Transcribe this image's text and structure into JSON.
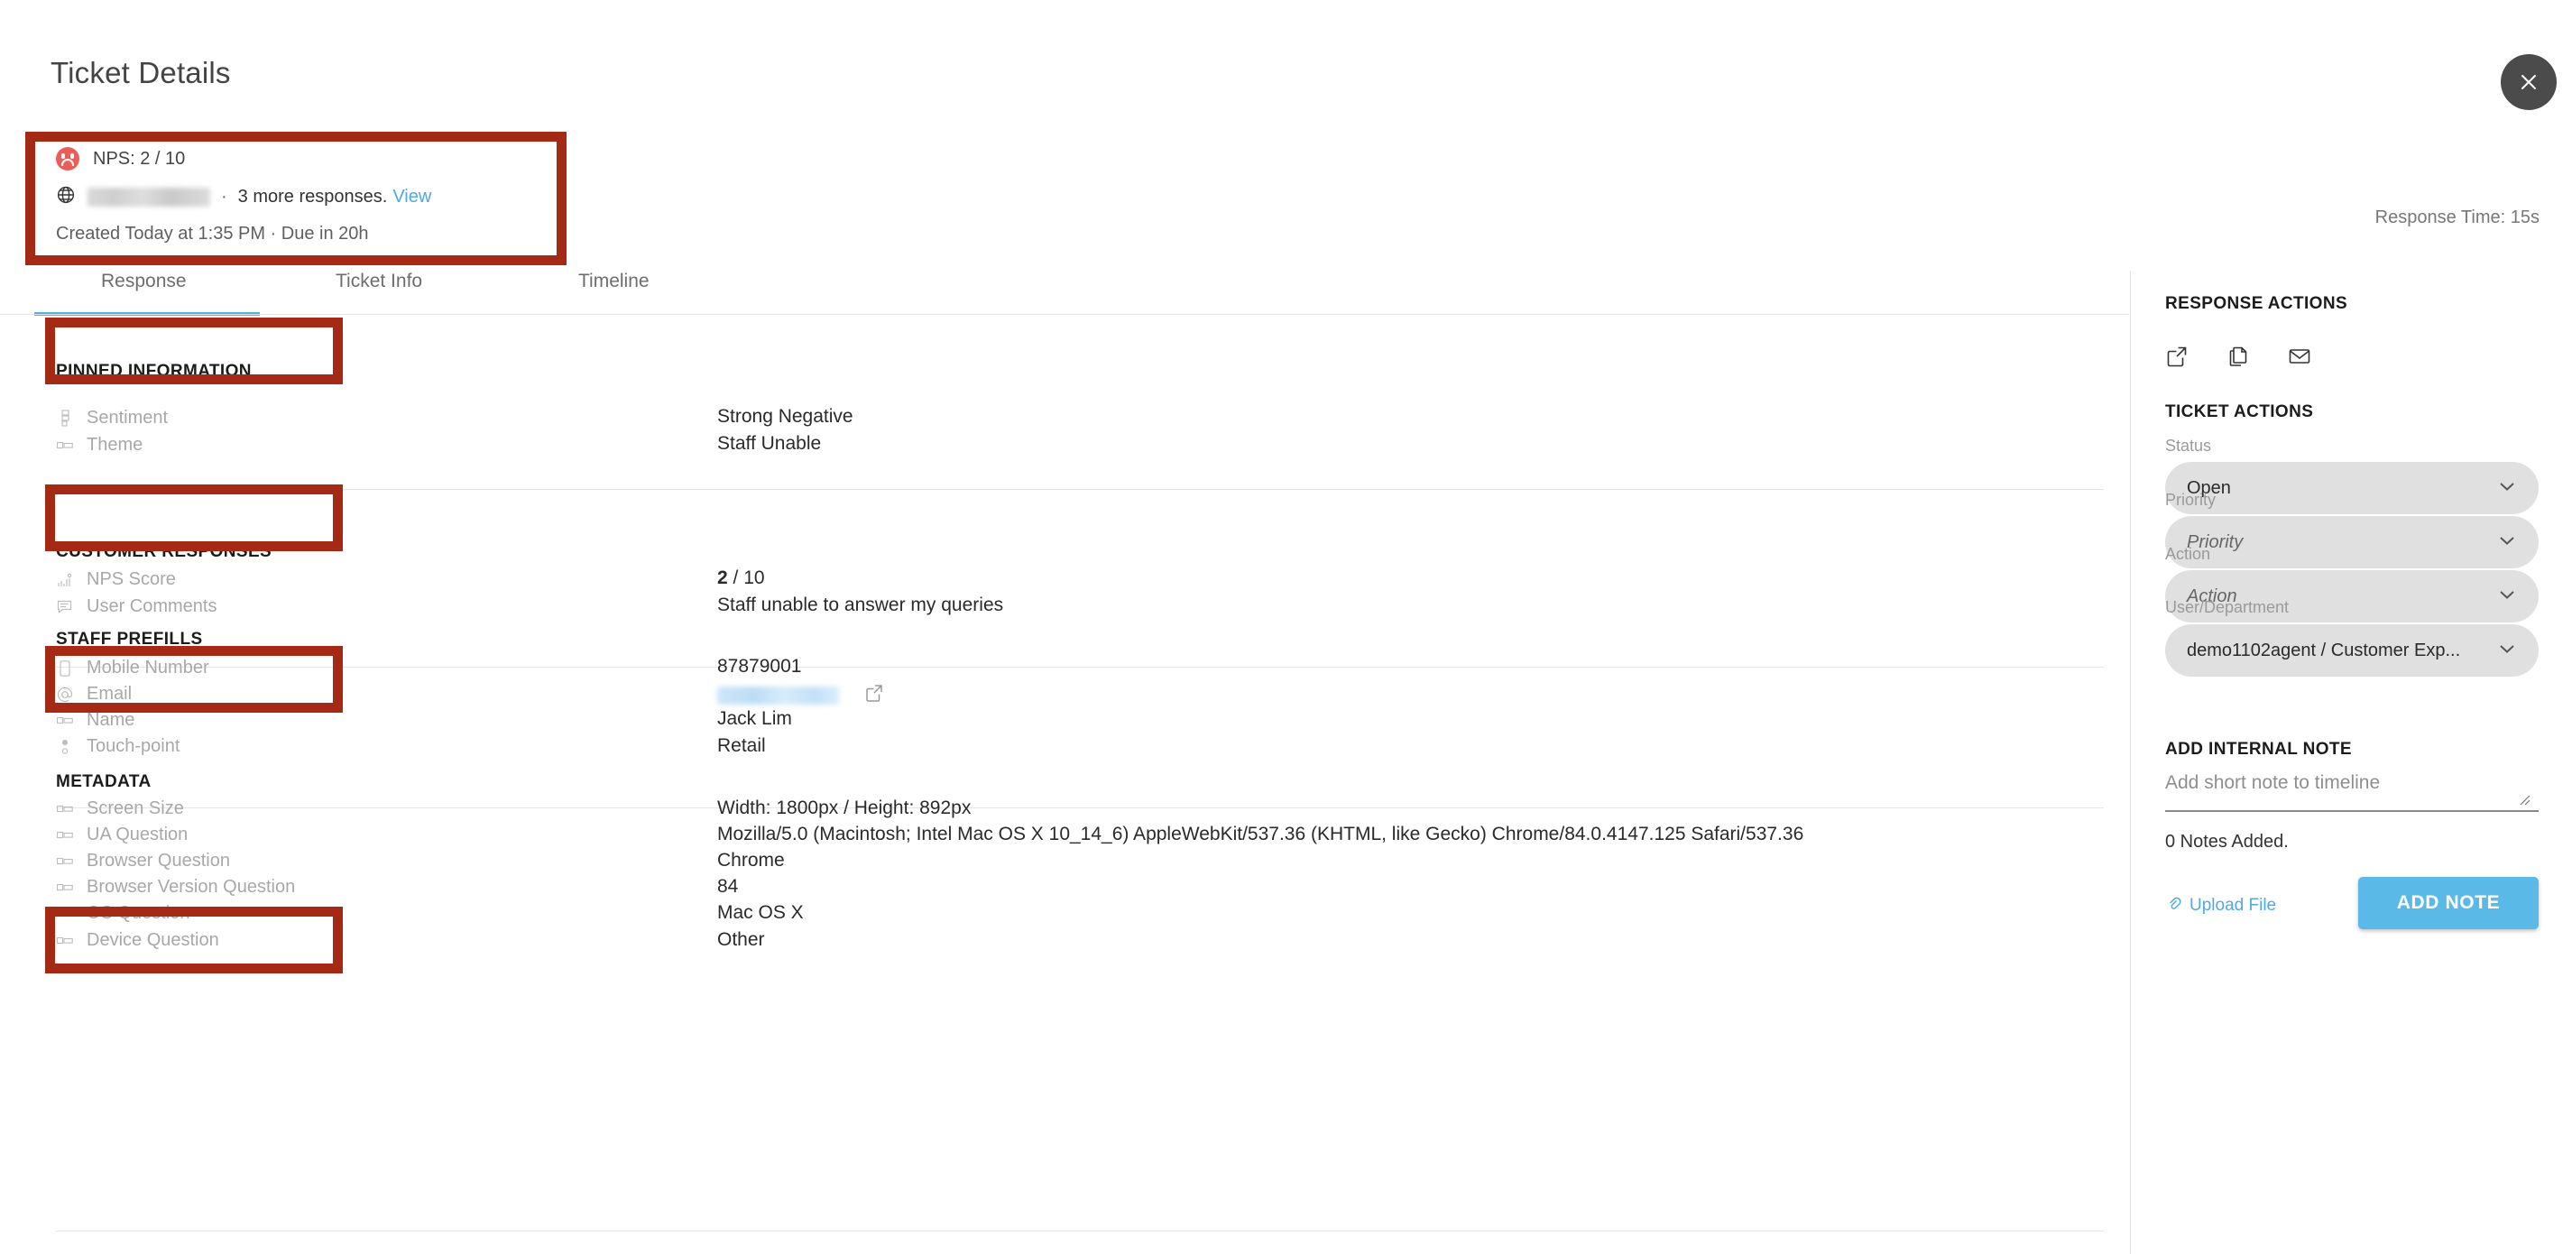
{
  "header": {
    "title": "Ticket Details",
    "close_icon": "close-icon",
    "response_time": "Response Time: 15s"
  },
  "summary": {
    "sentiment_icon": "sad-face-icon",
    "nps_text": "NPS: 2 / 10",
    "globe_icon": "globe-icon",
    "origin_redacted": "",
    "separator": "·",
    "more_responses": "3 more responses.",
    "view_link": "View",
    "created_due": "Created Today at 1:35 PM  ·  Due in 20h"
  },
  "tabs": [
    {
      "label": "Response",
      "active": true
    },
    {
      "label": "Ticket Info",
      "active": false
    },
    {
      "label": "Timeline",
      "active": false
    }
  ],
  "sections": [
    {
      "heading": "PINNED INFORMATION",
      "fields": [
        {
          "icon": "ranking-icon",
          "label": "Sentiment",
          "value": "Strong Negative"
        },
        {
          "icon": "text-box-icon",
          "label": "Theme",
          "value": "Staff Unable"
        }
      ]
    },
    {
      "heading": "CUSTOMER RESPONSES",
      "fields": [
        {
          "icon": "bar-chart-icon",
          "label": "NPS Score",
          "value_bold": "2",
          "value_rest": " / 10"
        },
        {
          "icon": "comment-icon",
          "label": "User Comments",
          "value": "Staff unable to answer my queries"
        }
      ]
    },
    {
      "heading": "STAFF PREFILLS",
      "fields": [
        {
          "icon": "mobile-icon",
          "label": "Mobile Number",
          "value": "87879001"
        },
        {
          "icon": "at-icon",
          "label": "Email",
          "value": "",
          "redacted": true,
          "link_icon": "external-link-icon"
        },
        {
          "icon": "text-box-icon",
          "label": "Name",
          "value": "Jack Lim"
        },
        {
          "icon": "pin-icon",
          "label": "Touch-point",
          "value": "Retail"
        }
      ]
    },
    {
      "heading": "METADATA",
      "fields": [
        {
          "icon": "text-box-icon",
          "label": "Screen Size",
          "value": "Width: 1800px / Height: 892px"
        },
        {
          "icon": "text-box-icon",
          "label": "UA Question",
          "value": "Mozilla/5.0 (Macintosh; Intel Mac OS X 10_14_6) AppleWebKit/537.36 (KHTML, like Gecko) Chrome/84.0.4147.125 Safari/537.36"
        },
        {
          "icon": "text-box-icon",
          "label": "Browser Question",
          "value": "Chrome"
        },
        {
          "icon": "text-box-icon",
          "label": "Browser Version Question",
          "value": "84"
        },
        {
          "icon": "text-box-icon",
          "label": "OS Question",
          "value": "Mac OS X"
        },
        {
          "icon": "text-box-icon",
          "label": "Device Question",
          "value": "Other"
        }
      ]
    }
  ],
  "right_panel": {
    "response_actions_heading": "RESPONSE ACTIONS",
    "action_icons": [
      {
        "name": "external-link-icon"
      },
      {
        "name": "copy-icon"
      },
      {
        "name": "mail-icon"
      }
    ],
    "ticket_actions_heading": "TICKET ACTIONS",
    "status": {
      "label": "Status",
      "value": "Open",
      "is_placeholder": false
    },
    "priority": {
      "label": "Priority",
      "value": "Priority",
      "is_placeholder": true
    },
    "action": {
      "label": "Action",
      "value": "Action",
      "is_placeholder": true
    },
    "user_department": {
      "label": "User/Department",
      "value": "demo1102agent / Customer Exp...",
      "is_placeholder": false
    },
    "add_note_heading": "ADD INTERNAL NOTE",
    "note_placeholder": "Add short note to timeline",
    "notes_count": "0 Notes Added.",
    "upload_label": "Upload File",
    "upload_icon": "upload-icon",
    "add_note_button": "ADD NOTE"
  },
  "colors": {
    "accent_blue": "#57b2e0",
    "button_blue": "#5bb9e8",
    "annotation_red": "#a52a16",
    "sad_face_red": "#ea5e5a",
    "label_gray": "#a8a8a8"
  },
  "annotations": [
    {
      "name": "summary-card-highlight"
    },
    {
      "name": "pinned-information-highlight"
    },
    {
      "name": "customer-responses-highlight"
    },
    {
      "name": "staff-prefills-highlight"
    },
    {
      "name": "metadata-highlight"
    }
  ]
}
